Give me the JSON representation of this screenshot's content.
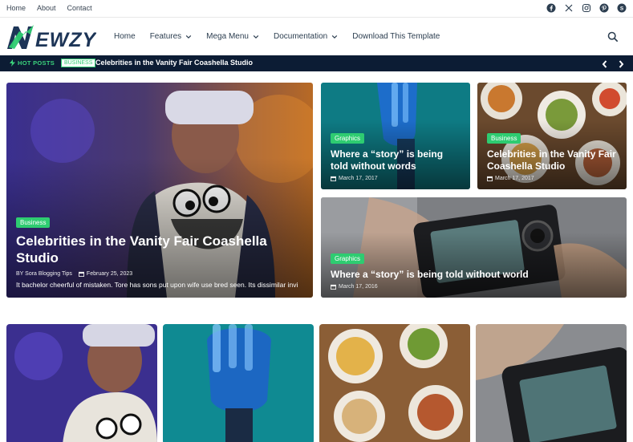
{
  "topnav": [
    "Home",
    "About",
    "Contact"
  ],
  "social_icons": [
    "facebook-icon",
    "x-icon",
    "instagram-icon",
    "pinterest-icon",
    "skype-icon"
  ],
  "logo_text": "EWZY",
  "mainnav": [
    {
      "label": "Home",
      "dropdown": false
    },
    {
      "label": "Features",
      "dropdown": true
    },
    {
      "label": "Mega Menu",
      "dropdown": true
    },
    {
      "label": "Documentation",
      "dropdown": true
    },
    {
      "label": "Download This Template",
      "dropdown": false
    }
  ],
  "ticker": {
    "hot_label": "HOT POSTS",
    "category": "BUSINESS",
    "headline": "Celebrities in the Vanity Fair Coashella Studio"
  },
  "featured": {
    "main": {
      "tag": "Business",
      "title": "Celebrities in the Vanity Fair Coashella Studio",
      "author": "BY Sora Blogging Tips",
      "date": "February 25, 2023",
      "excerpt": "It bachelor cheerful of mistaken. Tore has sons put upon wife use bred seen. Its dissimilar invi"
    },
    "top_left": {
      "tag": "Graphics",
      "title": "Where a “story” is being told without words",
      "date": "March 17, 2017"
    },
    "top_right": {
      "tag": "Business",
      "title": "Celebrities in the Vanity Fair Coashella Studio",
      "date": "March 17, 2017"
    },
    "wide": {
      "tag": "Graphics",
      "title": "Where a “story” is being told without world",
      "date": "March 17, 2016"
    }
  },
  "colors": {
    "accent": "#2ecc71",
    "navy": "#0c1c34",
    "logo_green": "#2ecc71",
    "logo_navy": "#1d3557"
  }
}
